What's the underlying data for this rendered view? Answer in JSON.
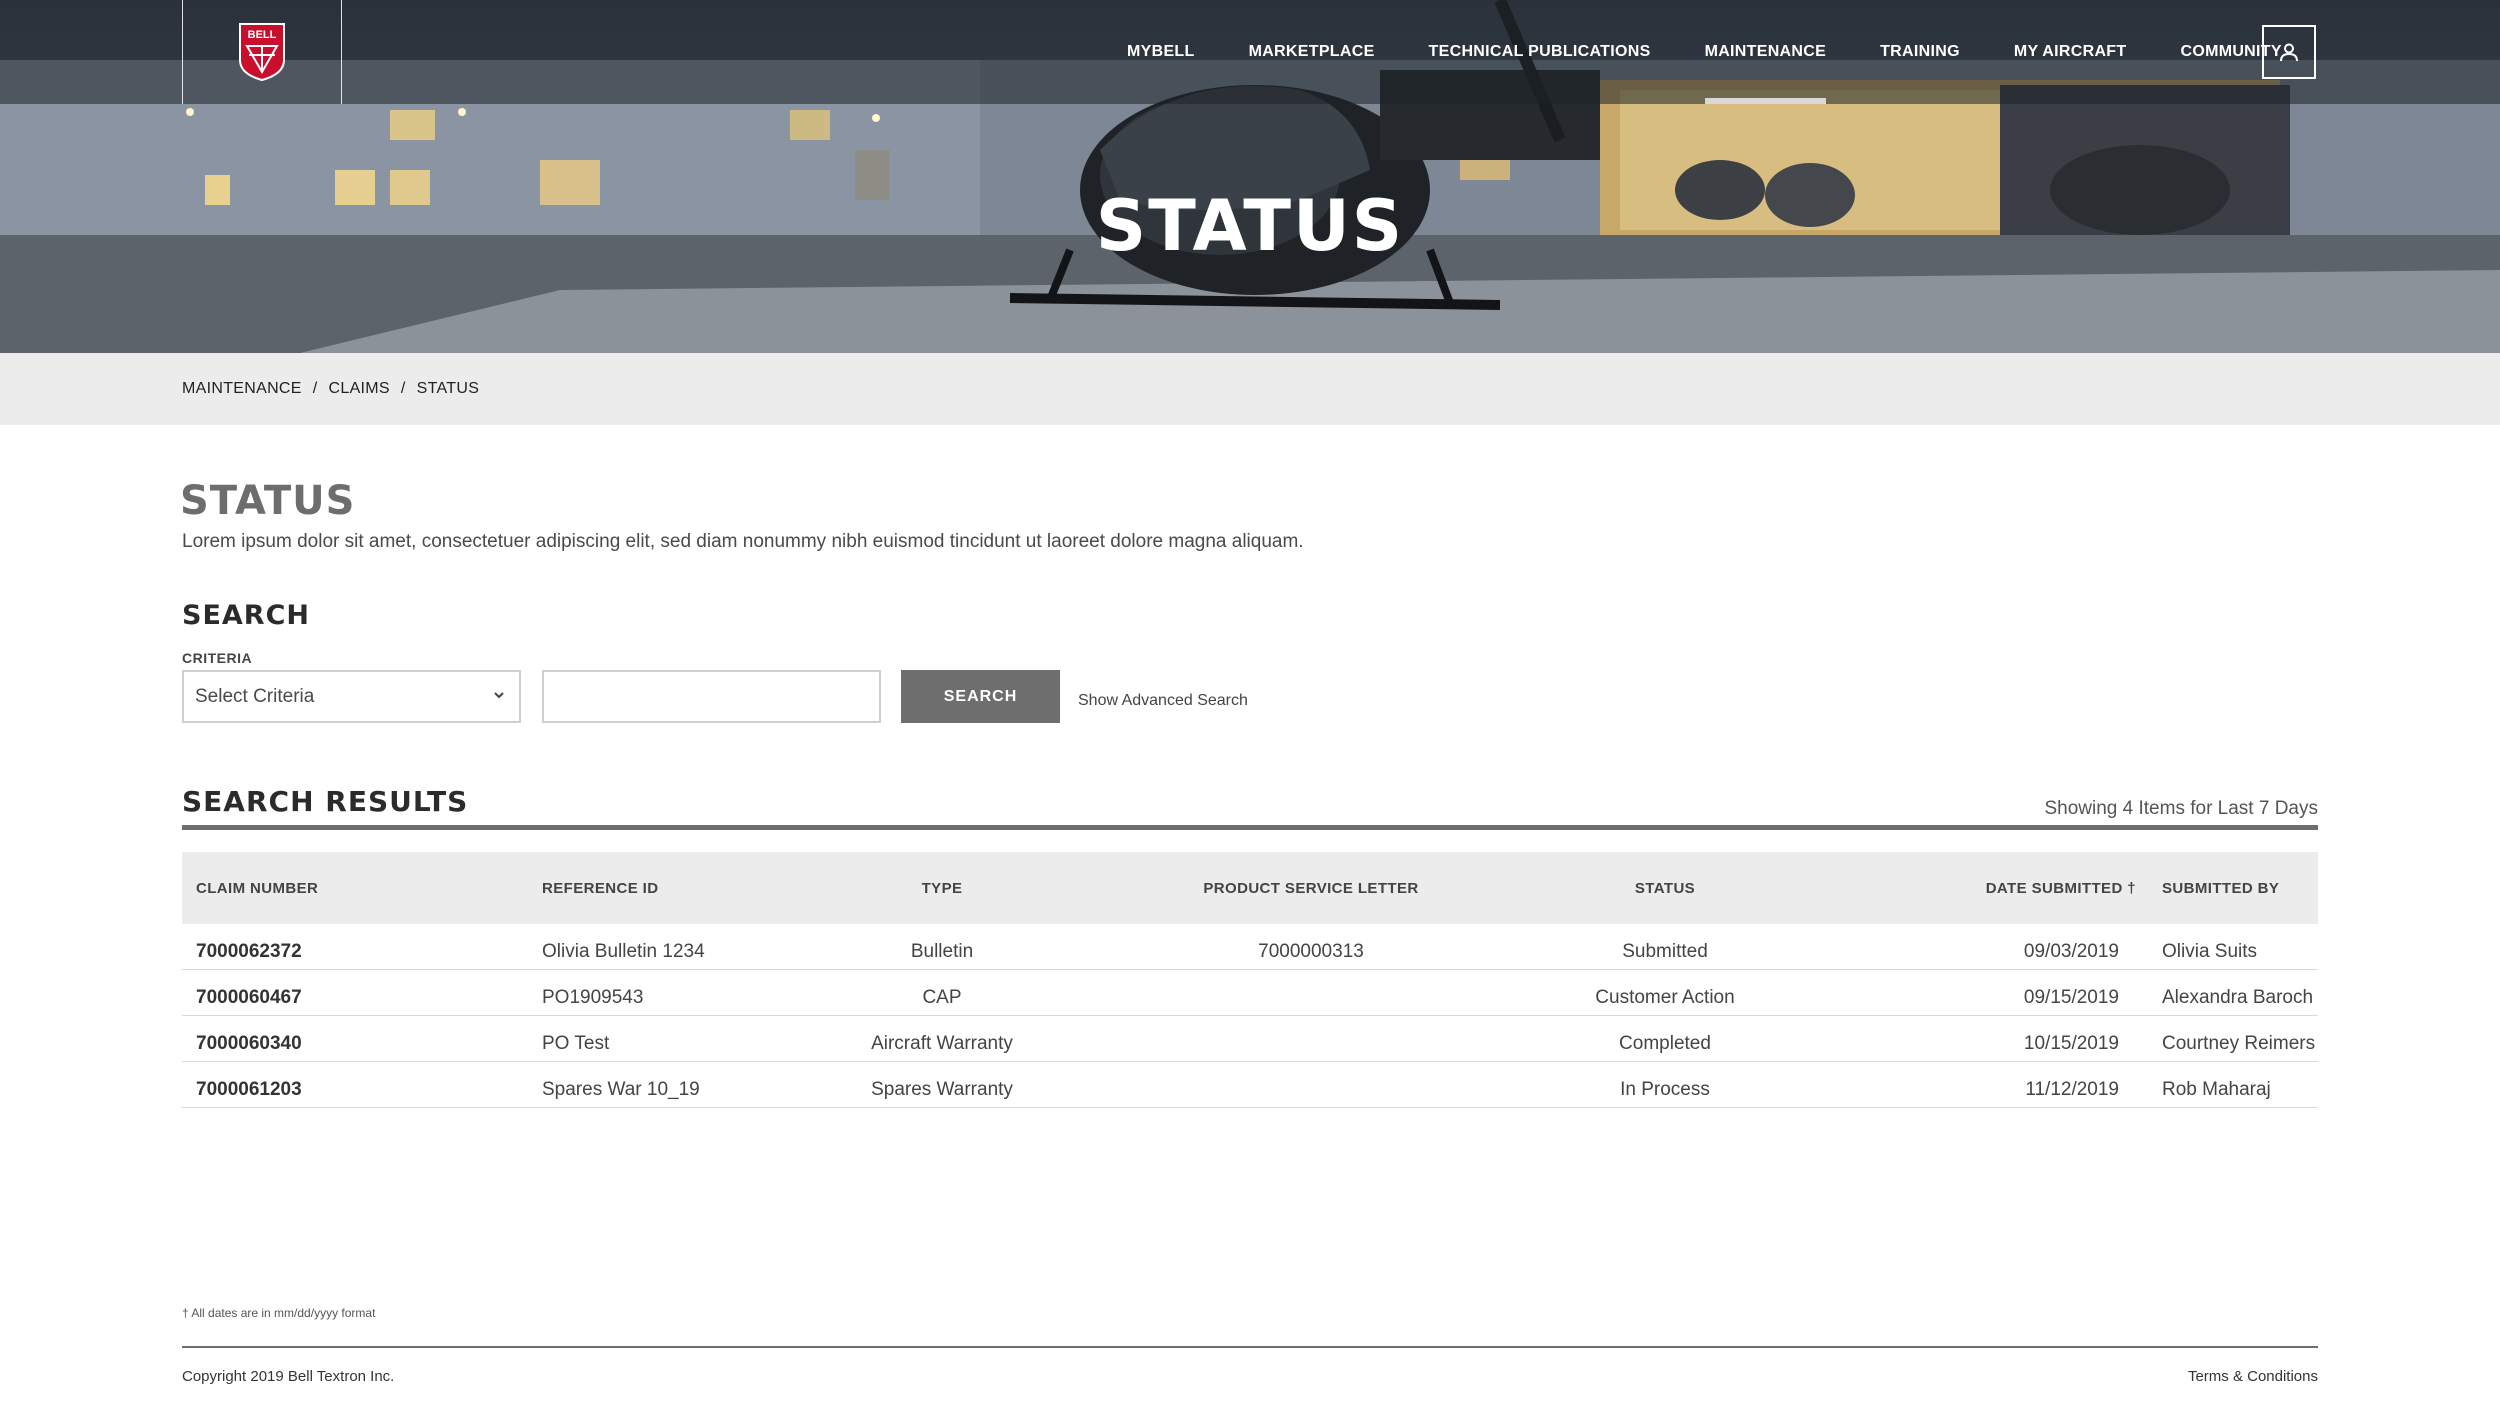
{
  "brand": {
    "logo_text": "BELL"
  },
  "nav": {
    "items": [
      {
        "label": "MYBELL",
        "active": false
      },
      {
        "label": "MARKETPLACE",
        "active": false
      },
      {
        "label": "TECHNICAL PUBLICATIONS",
        "active": false
      },
      {
        "label": "MAINTENANCE",
        "active": true
      },
      {
        "label": "TRAINING",
        "active": false
      },
      {
        "label": "MY AIRCRAFT",
        "active": false
      },
      {
        "label": "COMMUNITY",
        "active": false
      }
    ],
    "user_icon": "user-icon"
  },
  "hero": {
    "title": "STATUS"
  },
  "breadcrumb": {
    "items": [
      "MAINTENANCE",
      "CLAIMS",
      "STATUS"
    ],
    "separator": "/"
  },
  "main": {
    "title": "STATUS",
    "intro": "Lorem ipsum dolor sit amet, consectetuer adipiscing elit, sed diam nonummy nibh euismod tincidunt ut laoreet dolore magna aliquam."
  },
  "search": {
    "heading": "SEARCH",
    "criteria_label": "CRITERIA",
    "criteria_value": "Select Criteria",
    "input_value": "",
    "input_placeholder": "",
    "button_label": "SEARCH",
    "advanced_link": "Show Advanced Search"
  },
  "results": {
    "heading": "SEARCH RESULTS",
    "count_text": "Showing 4 Items for Last 7 Days",
    "columns": [
      "CLAIM NUMBER",
      "REFERENCE ID",
      "TYPE",
      "PRODUCT SERVICE LETTER",
      "STATUS",
      "DATE SUBMITTED †",
      "SUBMITTED BY"
    ],
    "rows": [
      [
        "7000062372",
        "Olivia Bulletin 1234",
        "Bulletin",
        "7000000313",
        "Submitted",
        "09/03/2019",
        "Olivia Suits"
      ],
      [
        "7000060467",
        "PO1909543",
        "CAP",
        "",
        "Customer Action",
        "09/15/2019",
        "Alexandra Baroch"
      ],
      [
        "7000060340",
        "PO Test",
        "Aircraft Warranty",
        "",
        "Completed",
        "10/15/2019",
        "Courtney Reimers"
      ],
      [
        "7000061203",
        "Spares War 10_19",
        "Spares Warranty",
        "",
        "In Process",
        "11/12/2019",
        "Rob Maharaj"
      ]
    ]
  },
  "footer": {
    "footnote": "† All dates are in mm/dd/yyyy format",
    "copyright": "Copyright 2019 Bell Textron Inc.",
    "terms": "Terms & Conditions"
  },
  "colors": {
    "nav_active": "#d9d9d9",
    "button": "#6e6e6e",
    "crumb_bg": "#ececec",
    "logo_red": "#c8102e"
  }
}
